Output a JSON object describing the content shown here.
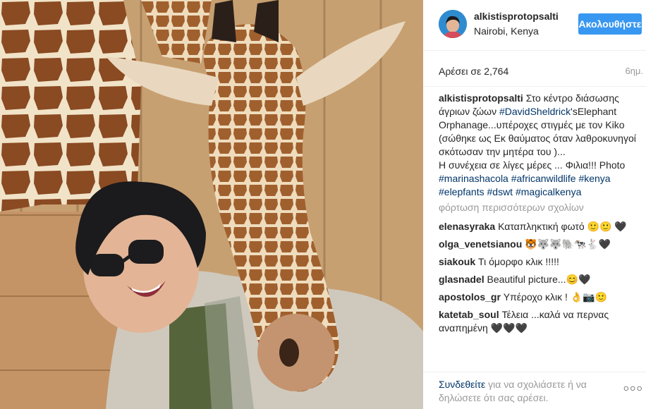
{
  "header": {
    "username": "alkistisprotopsalti",
    "location": "Nairobi, Kenya",
    "follow_label": "Ακολουθήστε"
  },
  "stats": {
    "likes": "Αρέσει σε 2,764",
    "time": "6ημ."
  },
  "caption": {
    "username": "alkistisprotopsalti",
    "text1": "Στο κέντρο διάσωσης άγριων ζώων",
    "tag1": "#DavidSheldrick",
    "text2": "'sElephant Orphanage...υπέροχες στιγμές με τον Kiko (σώθηκε ως Εκ θαύματος όταν λαθροκυνηγοί σκότωσαν την μητέρα του )...",
    "text3": "Η συνέχεια σε λίγες μέρες ... Φιλια!!! Photo",
    "tags": [
      "#marinashacola",
      "#africanwildlife",
      "#kenya",
      "#elepfants",
      "#dswt",
      "#magicalkenya"
    ]
  },
  "load_more": "φόρτωση περισσότερων σχολίων",
  "comments": [
    {
      "user": "elenasyraka",
      "text": "Καταπληκτική φωτό 🙂🙂 🖤"
    },
    {
      "user": "olga_venetsianou",
      "text": "🐯🐺🐺🐘🐄🐇🖤"
    },
    {
      "user": "siakouk",
      "text": "Τι όμορφο κλικ !!!!!"
    },
    {
      "user": "glasnadel",
      "text": "Beautiful picture...😊🖤"
    },
    {
      "user": "apostolos_gr",
      "text": "Υπέροχο κλικ ! 👌📷🙂"
    },
    {
      "user": "katetab_soul",
      "text": "Τέλεια ...καλά να περνας αναπημένη 🖤🖤🖤"
    }
  ],
  "footer": {
    "login_link": "Συνδεθείτε",
    "login_text": " για να σχολιάσετε ή να δηλώσετε ότι σας αρέσει.",
    "more_icon": "more-horizontal-icon"
  },
  "colors": {
    "accent": "#3897f0",
    "link": "#003569",
    "muted": "#999999"
  }
}
